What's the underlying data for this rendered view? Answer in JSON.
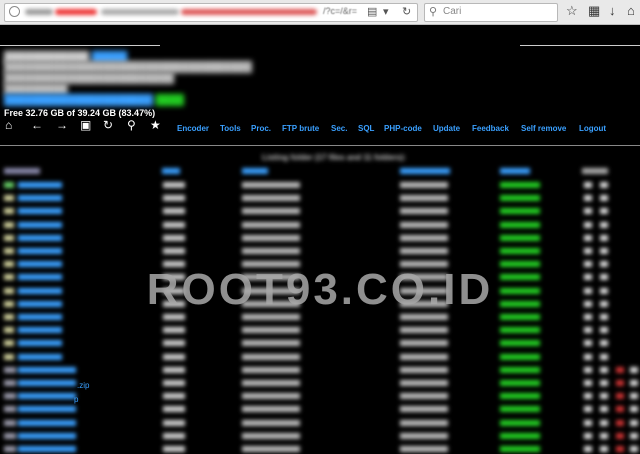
{
  "browser": {
    "url_suffix": "/?c=/&r=",
    "search_placeholder": "Cari"
  },
  "disk": {
    "free_text": "Free 32.76 GB of 39.24 GB (83.47%)"
  },
  "nav": [
    "Encoder",
    "Tools",
    "Proc.",
    "FTP brute",
    "Sec.",
    "SQL",
    "PHP-code",
    "Update",
    "Feedback",
    "Self remove",
    "Logout"
  ],
  "listing": {
    "title": "Listing folder (17 files and 11 folders):"
  },
  "file_ext": [
    ".zip",
    "p"
  ],
  "watermark": "ROOT93.CO.ID",
  "colors": {
    "link": "#3aa0ff",
    "perm": "#22cc22",
    "bg": "#000000"
  }
}
